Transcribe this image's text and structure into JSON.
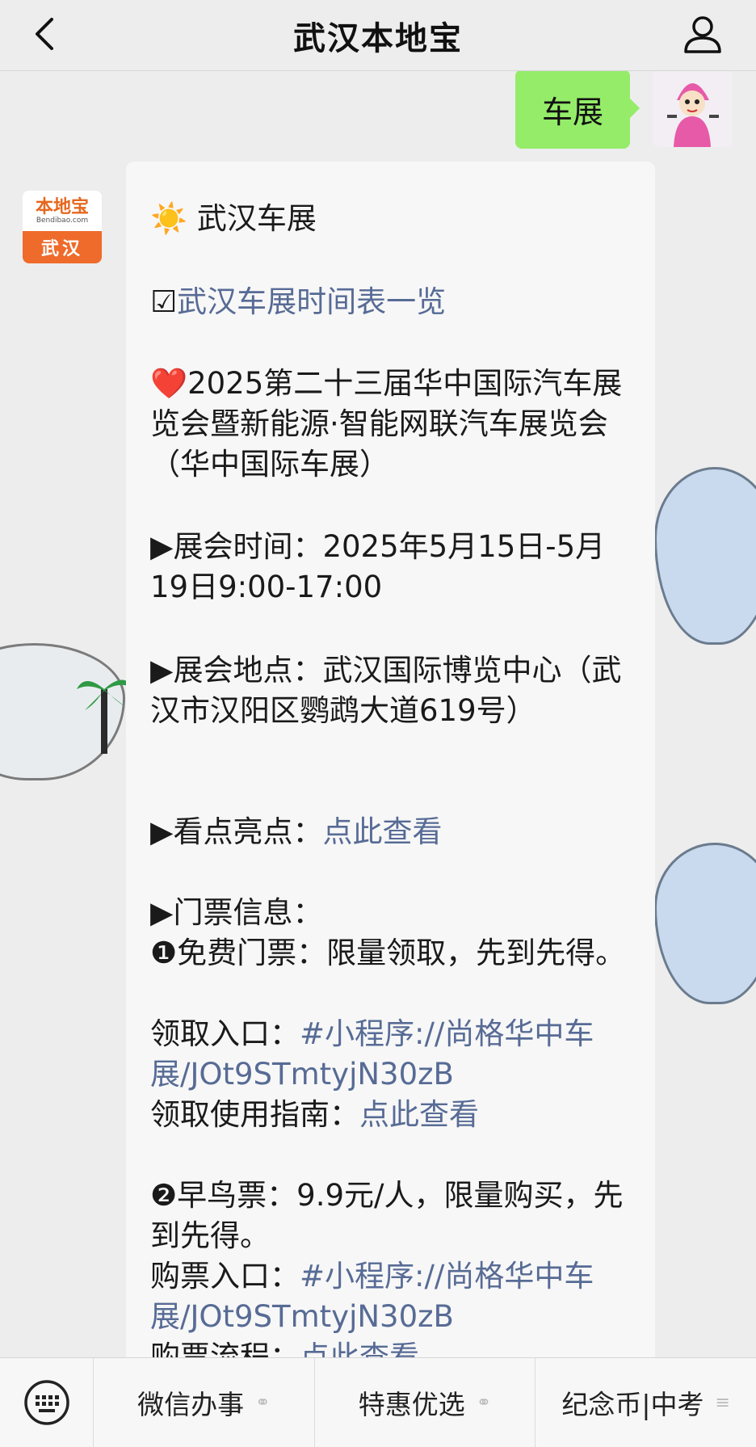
{
  "header": {
    "title": "武汉本地宝"
  },
  "user_message": {
    "text": "车展"
  },
  "bot": {
    "avatar_logo": "本地宝",
    "avatar_url": "Bendibao.com",
    "avatar_city": "武汉",
    "lines": [
      {
        "prefix": "☀️ ",
        "text": "武汉车展"
      },
      {
        "prefix": "☑",
        "link": "武汉车展时间表一览"
      },
      {
        "prefix": "❤️",
        "text": "2025第二十三届华中国际汽车展览会暨新能源·智能网联汽车展览会（华中国际车展）"
      },
      {
        "prefix": "▶",
        "text": "展会时间：2025年5月15日-5月19日9:00-17:00"
      },
      {
        "prefix": "▶",
        "text": "展会地点：武汉国际博览中心（武汉市汉阳区鹦鹉大道619号）"
      },
      {
        "prefix": "▶",
        "label": "看点亮点：",
        "link": "点此查看"
      },
      {
        "prefix": "▶",
        "text": "门票信息："
      },
      {
        "prefix": "❶",
        "text": "免费门票：限量领取，先到先得。"
      },
      {
        "label": "领取入口：",
        "link": "#小程序://尚格华中车展/JOt9STmtyjN30zB"
      },
      {
        "label": "领取使用指南：",
        "link": "点此查看"
      },
      {
        "prefix": "❷",
        "text": "早鸟票：9.9元/人，限量购买，先到先得。"
      },
      {
        "label": "购票入口：",
        "link": "#小程序://尚格华中车展/JOt9STmtyjN30zB"
      },
      {
        "label": "购票流程：",
        "link": "点此查看"
      }
    ]
  },
  "menubar": {
    "items": [
      {
        "label": "微信办事",
        "icon": "link-icon"
      },
      {
        "label": "特惠优选",
        "icon": "link-icon"
      },
      {
        "label": "纪念币|中考",
        "icon": "menu-icon"
      }
    ]
  },
  "colors": {
    "background": "#ededed",
    "user_bubble": "#95ec69",
    "link": "#576b95",
    "brand_orange": "#ee6b2b"
  }
}
